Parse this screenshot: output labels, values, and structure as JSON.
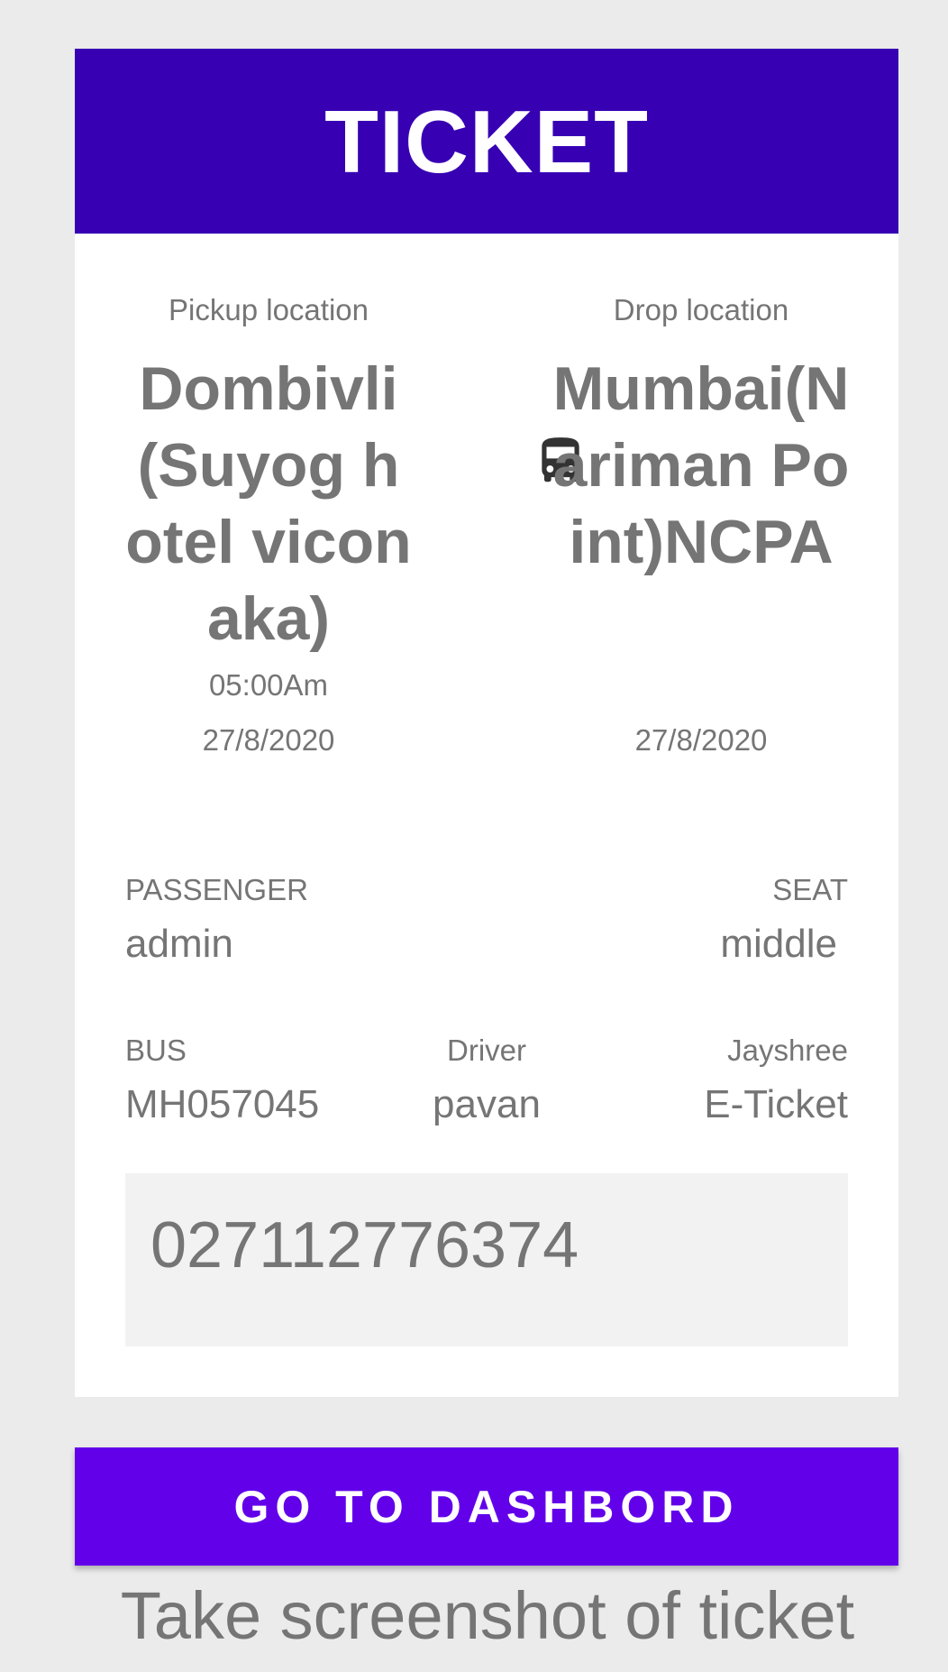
{
  "ticket": {
    "title": "TICKET",
    "pickup": {
      "label": "Pickup location",
      "name": "Dombivli(Suyog hotel viconaka)",
      "time": "05:00Am",
      "date": "27/8/2020"
    },
    "drop": {
      "label": "Drop location",
      "name": "Mumbai(Nariman Point)NCPA",
      "time": "",
      "date": "27/8/2020"
    },
    "transport_icon": "bus-icon",
    "passenger": {
      "label": "PASSENGER",
      "value": "admin"
    },
    "seat": {
      "label": "SEAT",
      "value": "middle"
    },
    "bus": {
      "label": "BUS",
      "value": "MH057045"
    },
    "driver": {
      "label": "Driver",
      "value": "pavan"
    },
    "operator": {
      "label": "Jayshree",
      "value": "E-Ticket"
    },
    "ticket_number": "027112776374"
  },
  "actions": {
    "dashboard_label": "GO TO DASHBORD"
  },
  "hint": "Take screenshot of ticket",
  "colors": {
    "header": "#3700b3",
    "button": "#6200ea",
    "text": "#757575",
    "background": "#ebebeb"
  }
}
